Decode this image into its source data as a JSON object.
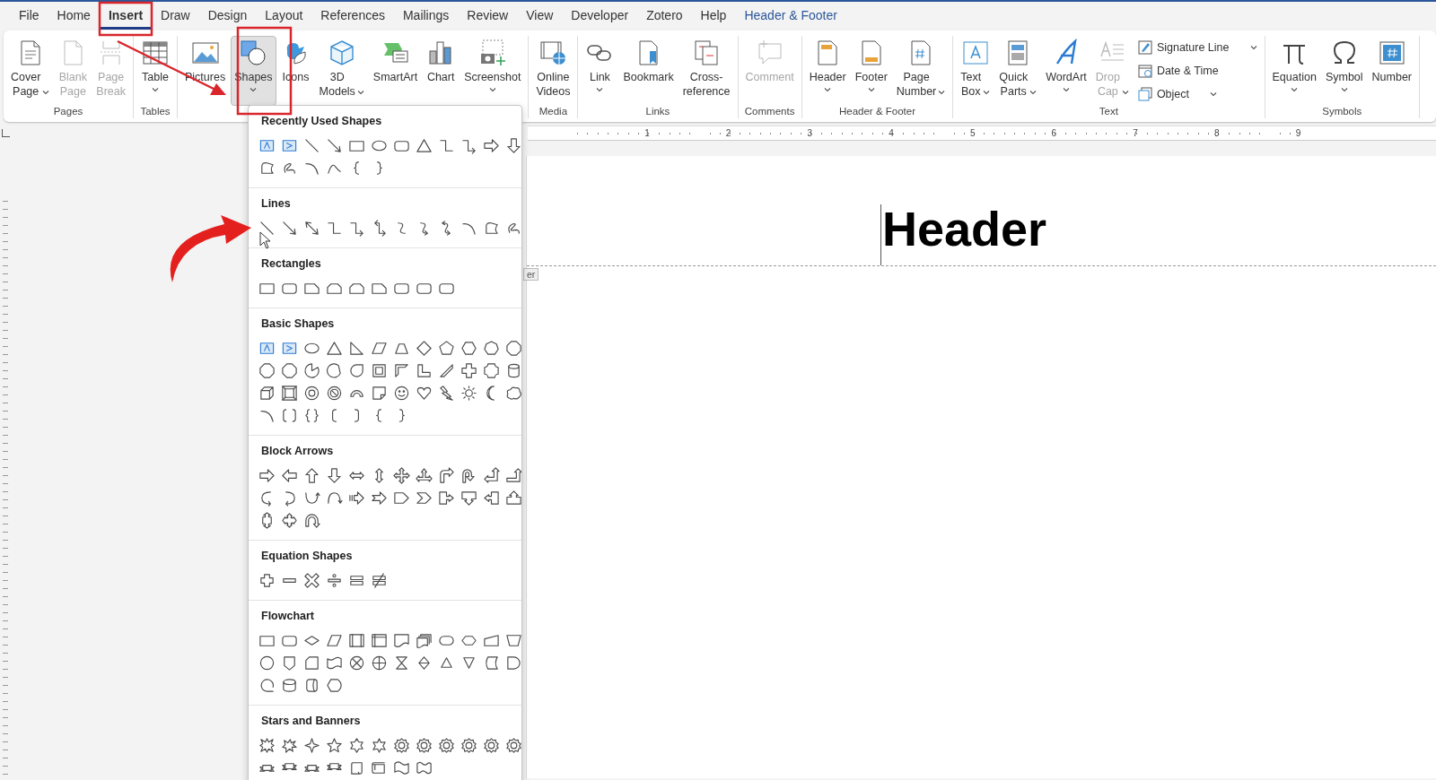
{
  "tabs": [
    {
      "label": "File",
      "selected": false,
      "kind": "normal"
    },
    {
      "label": "Home",
      "selected": false,
      "kind": "normal"
    },
    {
      "label": "Insert",
      "selected": true,
      "kind": "normal"
    },
    {
      "label": "Draw",
      "selected": false,
      "kind": "normal"
    },
    {
      "label": "Design",
      "selected": false,
      "kind": "normal"
    },
    {
      "label": "Layout",
      "selected": false,
      "kind": "normal"
    },
    {
      "label": "References",
      "selected": false,
      "kind": "normal"
    },
    {
      "label": "Mailings",
      "selected": false,
      "kind": "normal"
    },
    {
      "label": "Review",
      "selected": false,
      "kind": "normal"
    },
    {
      "label": "View",
      "selected": false,
      "kind": "normal"
    },
    {
      "label": "Developer",
      "selected": false,
      "kind": "normal"
    },
    {
      "label": "Zotero",
      "selected": false,
      "kind": "normal"
    },
    {
      "label": "Help",
      "selected": false,
      "kind": "normal"
    },
    {
      "label": "Header & Footer",
      "selected": false,
      "kind": "contextual"
    }
  ],
  "ribbon_groups": [
    {
      "label": "Pages",
      "buttons": [
        {
          "label": "Cover Page",
          "kind": "menu_inline",
          "disabled": false,
          "selected": false
        },
        {
          "label": "Blank Page",
          "kind": "plain",
          "disabled": true,
          "selected": false
        },
        {
          "label": "Page Break",
          "kind": "plain",
          "disabled": true,
          "selected": false
        }
      ]
    },
    {
      "label": "Tables",
      "buttons": [
        {
          "label": "Table",
          "kind": "menu_below",
          "disabled": false,
          "selected": false
        }
      ]
    },
    {
      "buttons": [
        {
          "label": "Pictures",
          "kind": "plain",
          "disabled": false,
          "selected": false
        },
        {
          "label": "Shapes",
          "kind": "menu_below",
          "disabled": false,
          "selected": true
        },
        {
          "label": "Icons",
          "kind": "plain",
          "disabled": false,
          "selected": false
        },
        {
          "label": "3D Models",
          "kind": "menu_inline",
          "disabled": false,
          "selected": false
        },
        {
          "label": "SmartArt",
          "kind": "plain",
          "disabled": false,
          "selected": false
        },
        {
          "label": "Chart",
          "kind": "plain",
          "disabled": false,
          "selected": false
        },
        {
          "label": "Screenshot",
          "kind": "menu_below",
          "disabled": false,
          "selected": false
        }
      ]
    },
    {
      "label": "Media",
      "buttons": [
        {
          "label": "Online Videos",
          "kind": "plain",
          "disabled": false,
          "selected": false
        }
      ]
    },
    {
      "label": "Links",
      "buttons": [
        {
          "label": "Link",
          "kind": "menu_below",
          "disabled": false,
          "selected": false
        },
        {
          "label": "Bookmark",
          "kind": "plain",
          "disabled": false,
          "selected": false
        },
        {
          "label": "Cross-reference",
          "kind": "plain",
          "disabled": false,
          "selected": false
        }
      ]
    },
    {
      "label": "Comments",
      "buttons": [
        {
          "label": "Comment",
          "kind": "plain",
          "disabled": true,
          "selected": false
        }
      ]
    },
    {
      "label": "Header & Footer",
      "buttons": [
        {
          "label": "Header",
          "kind": "menu_below",
          "disabled": false,
          "selected": false
        },
        {
          "label": "Footer",
          "kind": "menu_below",
          "disabled": false,
          "selected": false
        },
        {
          "label": "Page Number",
          "kind": "menu_inline",
          "disabled": false,
          "selected": false
        }
      ]
    },
    {
      "label": "Text",
      "buttons": [
        {
          "label": "Text Box",
          "kind": "menu_inline",
          "disabled": false,
          "selected": false
        },
        {
          "label": "Quick Parts",
          "kind": "menu_inline",
          "disabled": false,
          "selected": false
        },
        {
          "label": "WordArt",
          "kind": "menu_below",
          "disabled": false,
          "selected": false
        },
        {
          "label": "Drop Cap",
          "kind": "menu_inline",
          "disabled": true,
          "selected": false
        }
      ],
      "small_buttons": [
        {
          "label": "Signature Line",
          "kind": "menu"
        },
        {
          "label": "Date & Time",
          "kind": "plain"
        },
        {
          "label": "Object",
          "kind": "menu"
        }
      ]
    },
    {
      "label": "Symbols",
      "buttons": [
        {
          "label": "Equation",
          "kind": "menu_below",
          "disabled": false,
          "selected": false
        },
        {
          "label": "Symbol",
          "kind": "menu_below",
          "disabled": false,
          "selected": false
        },
        {
          "label": "Number",
          "kind": "plain",
          "disabled": false,
          "selected": false
        }
      ]
    }
  ],
  "shapes_menu": {
    "sections": [
      {
        "title": "Recently Used Shapes"
      },
      {
        "title": "Lines"
      },
      {
        "title": "Rectangles"
      },
      {
        "title": "Basic Shapes"
      },
      {
        "title": "Block Arrows"
      },
      {
        "title": "Equation Shapes"
      },
      {
        "title": "Flowchart"
      },
      {
        "title": "Stars and Banners"
      }
    ]
  },
  "ruler": {
    "numbers": [
      "1",
      "2",
      "3",
      "4",
      "5",
      "6",
      "7",
      "8",
      "9"
    ]
  },
  "document": {
    "header_text": "Header",
    "header_tab": "er"
  }
}
